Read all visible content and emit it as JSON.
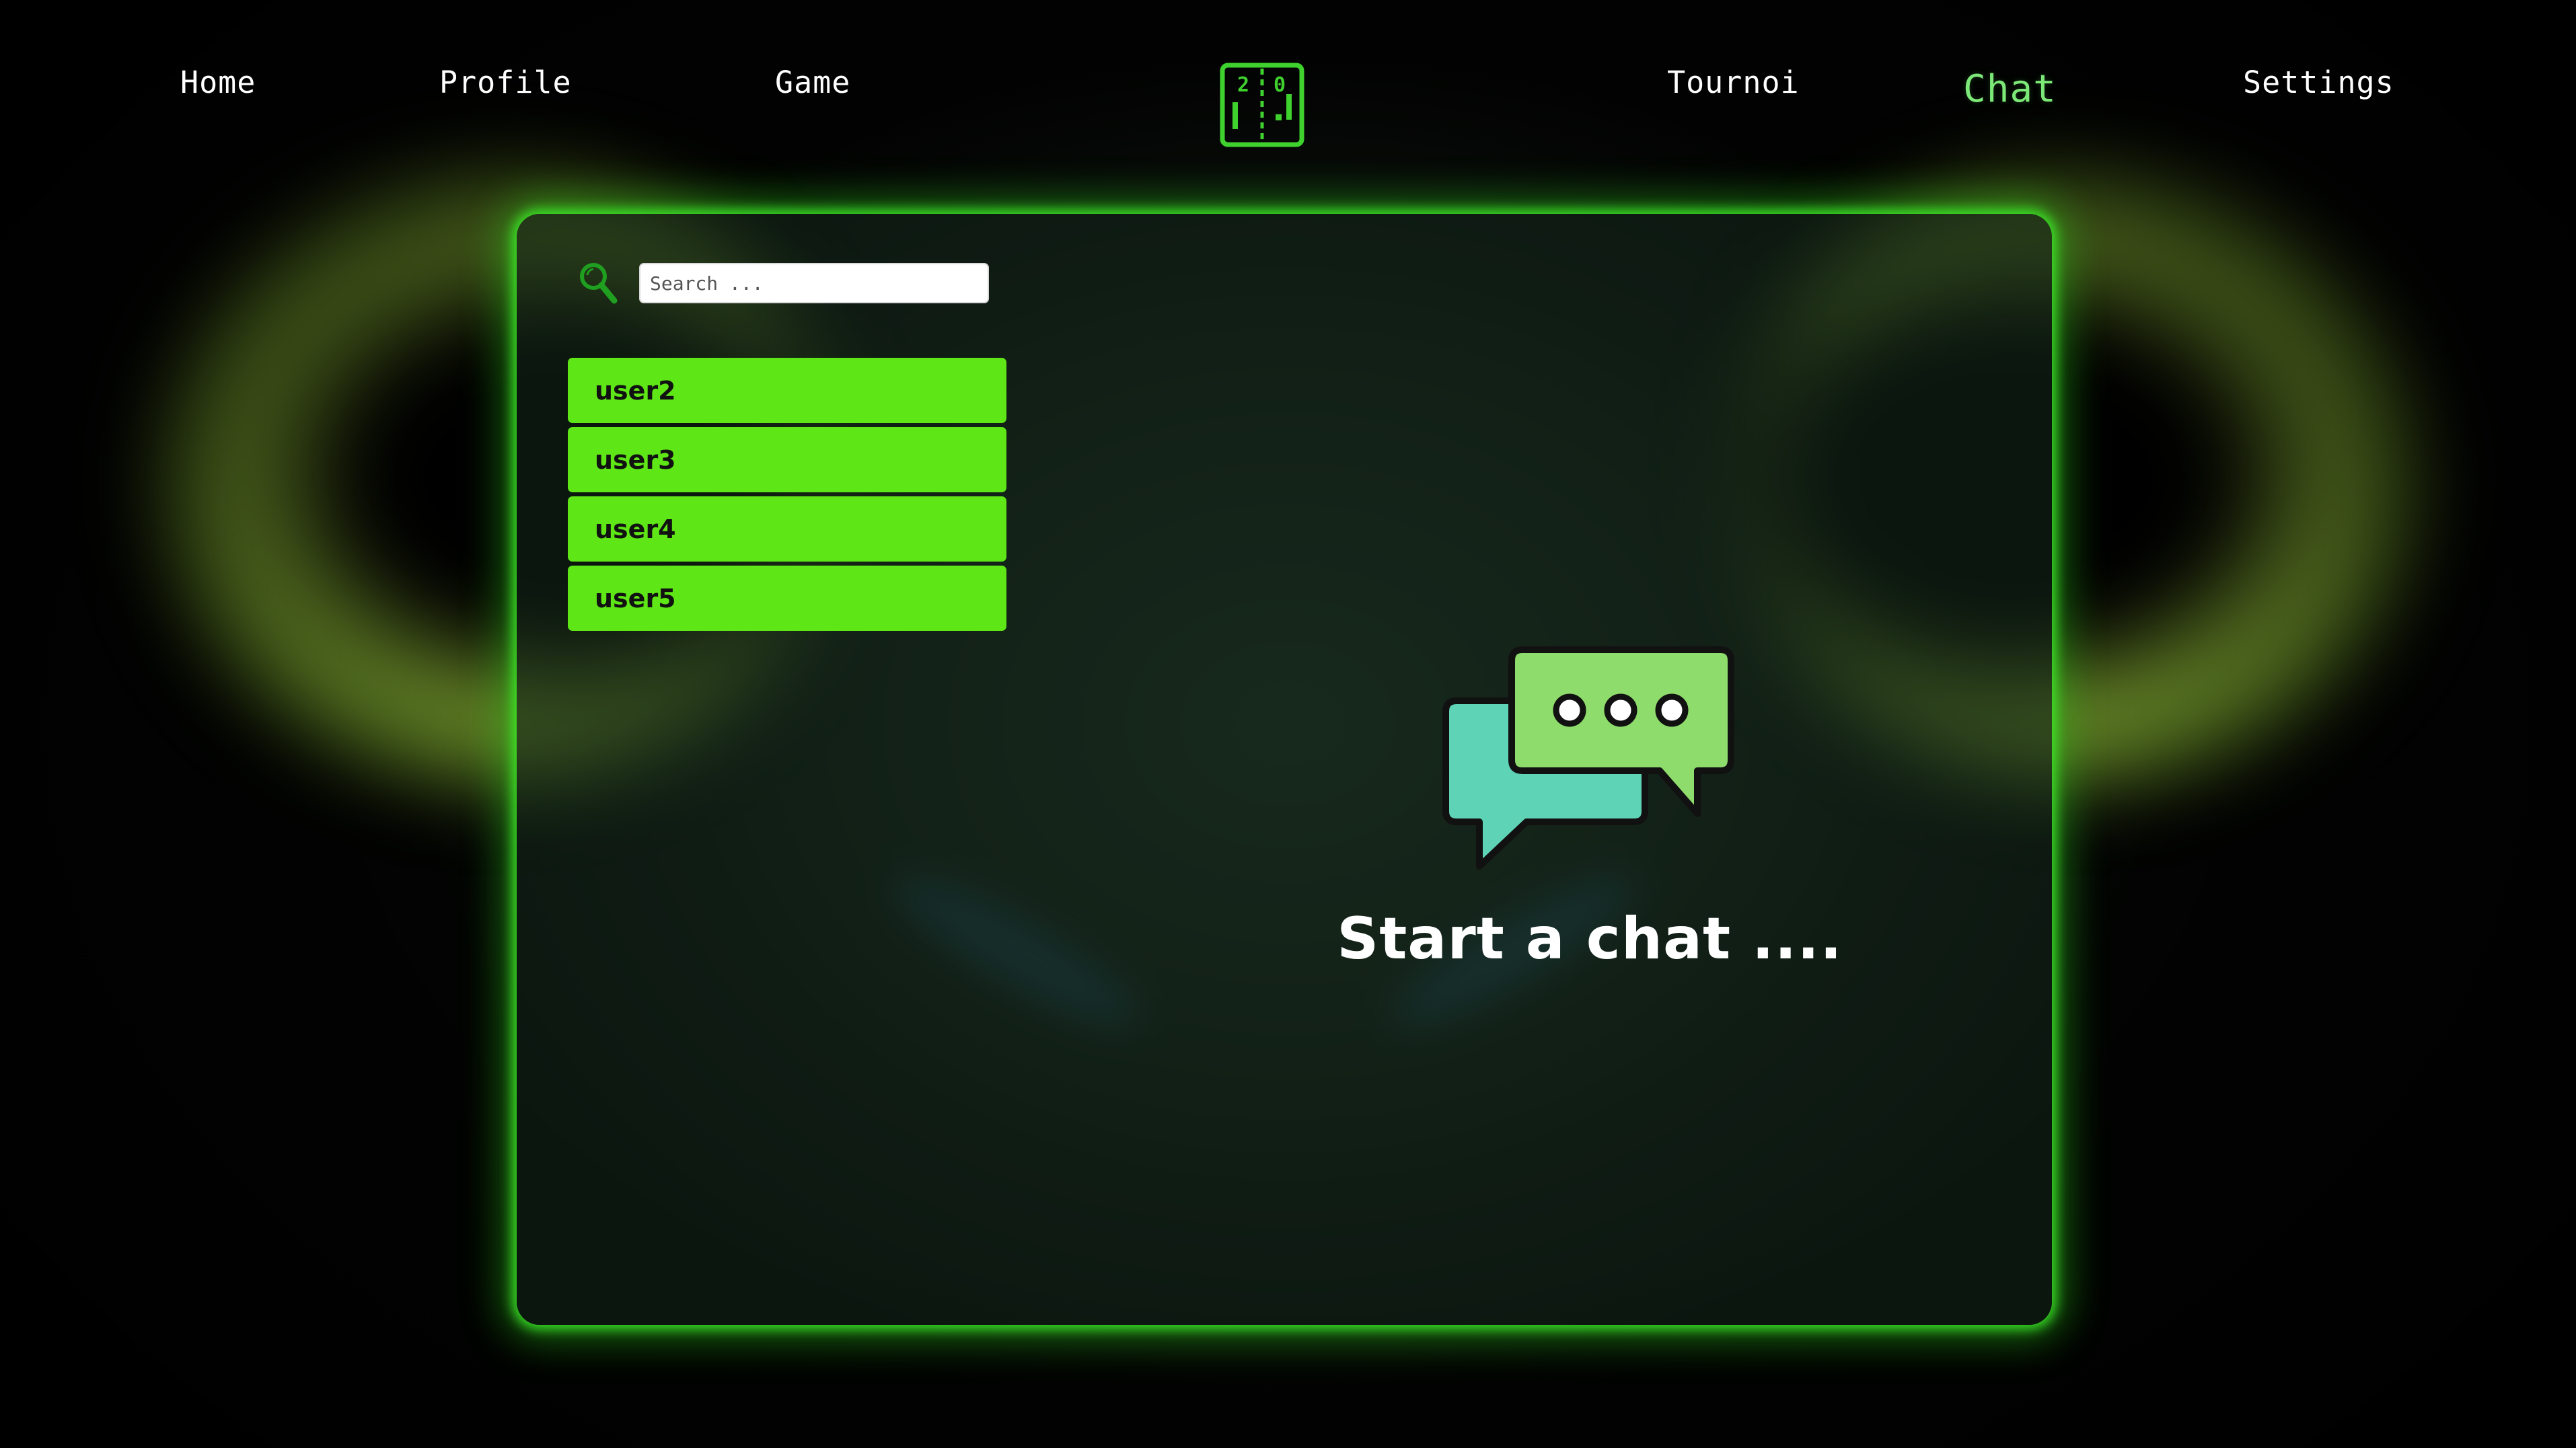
{
  "nav": {
    "home": "Home",
    "profile": "Profile",
    "game": "Game",
    "tournoi": "Tournoi",
    "chat": "Chat",
    "settings": "Settings",
    "active": "Chat",
    "logo_icon": "pong-scoreboard-icon",
    "logo_score_left": "2",
    "logo_score_right": "0"
  },
  "search": {
    "icon": "magnifier-icon",
    "placeholder": "Search ..."
  },
  "users": [
    {
      "name": "user2"
    },
    {
      "name": "user3"
    },
    {
      "name": "user4"
    },
    {
      "name": "user5"
    }
  ],
  "empty_state": {
    "icon": "chat-bubbles-icon",
    "text": "Start a chat ...."
  },
  "colors": {
    "accent_green": "#5ee616",
    "active_nav": "#7ce877",
    "panel_glow": "#3ceb28",
    "bubble_front": "#8edc6c",
    "bubble_back": "#5fd3b6"
  }
}
